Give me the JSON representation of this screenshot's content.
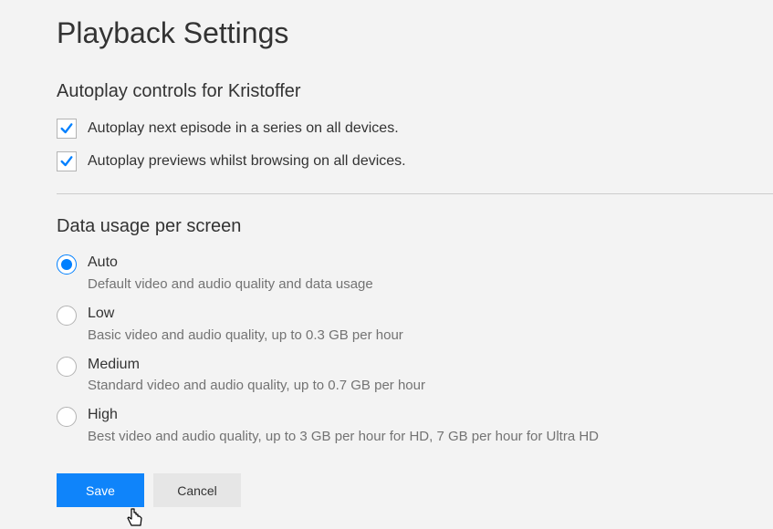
{
  "page_title": "Playback Settings",
  "autoplay": {
    "heading": "Autoplay controls for Kristoffer",
    "options": [
      {
        "label": "Autoplay next episode in a series on all devices.",
        "checked": true
      },
      {
        "label": "Autoplay previews whilst browsing on all devices.",
        "checked": true
      }
    ]
  },
  "data_usage": {
    "heading": "Data usage per screen",
    "options": [
      {
        "label": "Auto",
        "desc": "Default video and audio quality and data usage",
        "selected": true
      },
      {
        "label": "Low",
        "desc": "Basic video and audio quality, up to 0.3 GB per hour",
        "selected": false
      },
      {
        "label": "Medium",
        "desc": "Standard video and audio quality, up to 0.7 GB per hour",
        "selected": false
      },
      {
        "label": "High",
        "desc": "Best video and audio quality, up to 3 GB per hour for HD, 7 GB per hour for Ultra HD",
        "selected": false
      }
    ]
  },
  "buttons": {
    "save": "Save",
    "cancel": "Cancel"
  }
}
